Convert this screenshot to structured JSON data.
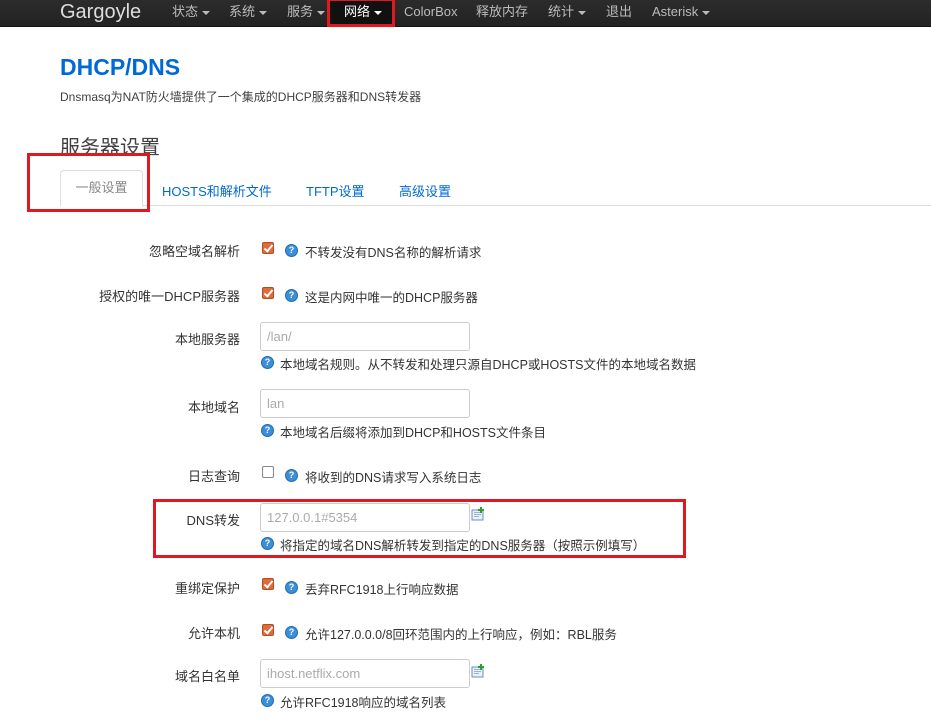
{
  "navbar": {
    "brand": "Gargoyle",
    "items": [
      {
        "label": "状态",
        "dropdown": true
      },
      {
        "label": "系统",
        "dropdown": true
      },
      {
        "label": "服务",
        "dropdown": true
      },
      {
        "label": "网络",
        "dropdown": true
      },
      {
        "label": "ColorBox",
        "dropdown": false
      },
      {
        "label": "释放内存",
        "dropdown": false
      },
      {
        "label": "统计",
        "dropdown": true
      },
      {
        "label": "退出",
        "dropdown": false
      },
      {
        "label": "Asterisk",
        "dropdown": true
      }
    ]
  },
  "page": {
    "title": "DHCP/DNS",
    "description": "Dnsmasq为NAT防火墙提供了一个集成的DHCP服务器和DNS转发器",
    "section_title": "服务器设置"
  },
  "tabs": [
    {
      "label": "一般设置",
      "active": true
    },
    {
      "label": "HOSTS和解析文件",
      "active": false
    },
    {
      "label": "TFTP设置",
      "active": false
    },
    {
      "label": "高级设置",
      "active": false
    }
  ],
  "form": {
    "ignore_empty": {
      "label": "忽略空域名解析",
      "checked": true,
      "help": "不转发没有DNS名称的解析请求"
    },
    "authoritative": {
      "label": "授权的唯一DHCP服务器",
      "checked": true,
      "help": "这是内网中唯一的DHCP服务器"
    },
    "local_server": {
      "label": "本地服务器",
      "placeholder": "/lan/",
      "help": "本地域名规则。从不转发和处理只源自DHCP或HOSTS文件的本地域名数据"
    },
    "local_domain": {
      "label": "本地域名",
      "placeholder": "lan",
      "help": "本地域名后缀将添加到DHCP和HOSTS文件条目"
    },
    "log_queries": {
      "label": "日志查询",
      "checked": false,
      "help": "将收到的DNS请求写入系统日志"
    },
    "dns_forward": {
      "label": "DNS转发",
      "placeholder": "127.0.0.1#5354",
      "help": "将指定的域名DNS解析转发到指定的DNS服务器（按照示例填写）"
    },
    "rebind_protection": {
      "label": "重绑定保护",
      "checked": true,
      "help": "丢弃RFC1918上行响应数据"
    },
    "allow_localhost": {
      "label": "允许本机",
      "checked": true,
      "help": "允许127.0.0.0/8回环范围内的上行响应，例如：RBL服务"
    },
    "domain_whitelist": {
      "label": "域名白名单",
      "placeholder": "ihost.netflix.com",
      "help": "允许RFC1918响应的域名列表"
    }
  },
  "colors": {
    "accent": "#0069d6",
    "highlight": "#e0181f",
    "navbar": "#222222",
    "checkbox": "#e06b3a"
  },
  "icons": {
    "help": "help-icon",
    "add": "add-icon",
    "dropdown": "caret-down-icon"
  }
}
